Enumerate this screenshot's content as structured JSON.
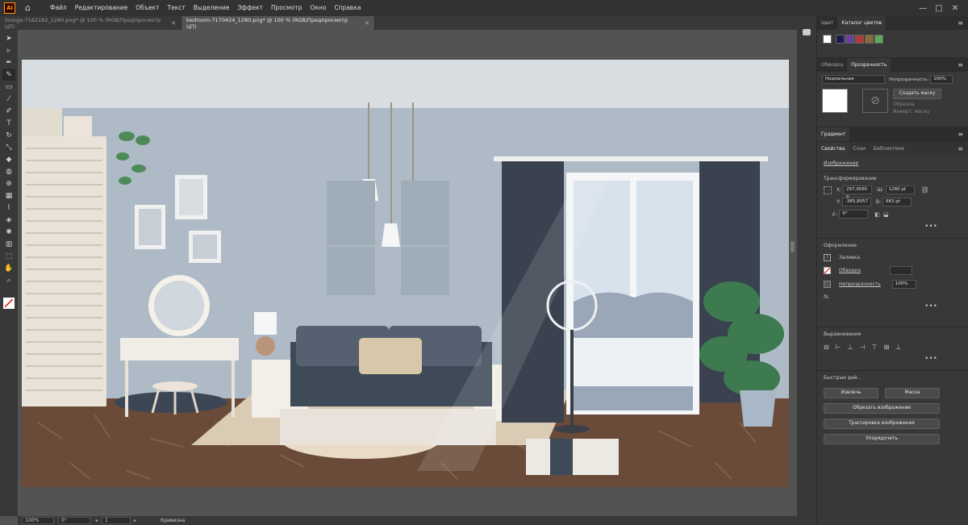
{
  "app": {
    "logo": "Ai"
  },
  "menu": [
    "Файл",
    "Редактирование",
    "Объект",
    "Текст",
    "Выделение",
    "Эффект",
    "Просмотр",
    "Окно",
    "Справка"
  ],
  "window_controls": [
    "—",
    "□",
    "✕"
  ],
  "tabs": [
    {
      "label": "lounge-7162162_1280.png* @ 100 % (RGB/Предпросмотр ЦП)",
      "close": "✕"
    },
    {
      "label": "bedroom-7170424_1280.png* @ 100 % (RGB/Предпросмотр ЦП)",
      "close": "✕"
    }
  ],
  "tools": [
    "selection-arrow-icon",
    "direct-select-icon",
    "pen-icon",
    "curvature-icon",
    "rectangle-icon",
    "brush-icon",
    "pencil-icon",
    "type-icon",
    "rotate-icon",
    "scale-icon",
    "eraser-icon",
    "warp-icon",
    "shape-builder-icon",
    "gradient-icon",
    "eyedropper-icon",
    "blend-icon",
    "symbol-sprayer-icon",
    "column-graph-icon",
    "artboard-icon",
    "hand-icon",
    "zoom-icon"
  ],
  "color_panel": {
    "tabs": [
      "Цвет",
      "Каталог цветов"
    ],
    "swatches": [
      "#ffffff",
      "#1a1a4e",
      "#6a3fa0",
      "#b03a3a",
      "#8a6a3a",
      "#5aaa5a"
    ]
  },
  "transparency_panel": {
    "tabs": [
      "Обводка",
      "Прозрачность"
    ],
    "blend_mode": "Нормальная",
    "opacity_label": "Непрозрачность:",
    "opacity_value": "100%",
    "make_mask": "Создать маску",
    "clip": "Обрезка",
    "invert": "Инверт. маску"
  },
  "gradient_tab": "Градиент",
  "props_panel": {
    "tabs": [
      "Свойства",
      "Слои",
      "Библиотеки"
    ],
    "object_type": "Изображение",
    "transform_title": "Трансформирование",
    "x_label": "X:",
    "x_value": "297,9565 р",
    "y_label": "Y:",
    "y_value": "-385,8057",
    "w_label": "Ш:",
    "w_value": "1280 pt",
    "h_label": "В:",
    "h_value": "663 pt",
    "angle_label": "∠:",
    "angle_value": "0°",
    "appearance_title": "Оформление",
    "fill_label": "Заливка",
    "stroke_label": "Обводка",
    "opacity_label": "Непрозрачность",
    "opacity_value": "100%",
    "fx_label": "fx.",
    "align_title": "Выравнивание",
    "quick_title": "Быстрые дей...",
    "extract_btn": "Извлечь",
    "mask_btn": "Маска",
    "crop_btn": "Обрезать изображение",
    "trace_btn": "Трассировка изображения",
    "arrange_btn": "Упорядочить"
  },
  "status": {
    "zoom": "100%",
    "rotate": "0°",
    "artboard": "1",
    "tool": "Кривизна"
  }
}
